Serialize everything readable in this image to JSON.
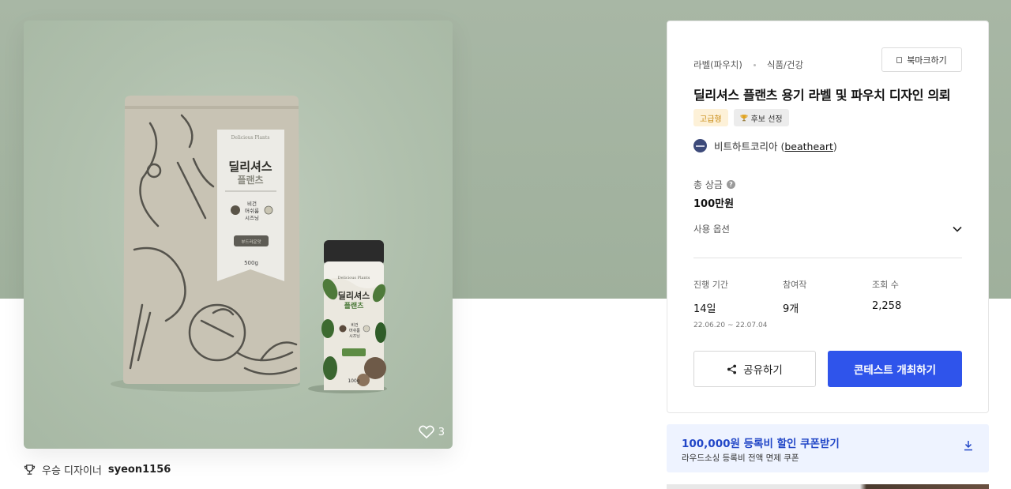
{
  "image": {
    "likes": "3",
    "bag": {
      "brand_script": "Delicious Plants",
      "name_line1": "딜리셔스",
      "name_line2": "플랜츠",
      "flavor_line1": "비건",
      "flavor_line2": "머쉬룸",
      "flavor_line3": "시즈닝",
      "tag": "부드러운맛",
      "weight": "500g"
    },
    "bottle": {
      "brand_script": "Delicious Plants",
      "name_line1": "딜리셔스",
      "name_line2": "플랜츠",
      "flavor_line1": "비건",
      "flavor_line2": "머쉬룸",
      "flavor_line3": "시즈닝",
      "weight": "100g"
    }
  },
  "winner": {
    "label": "우승 디자이너",
    "username": "syeon1156"
  },
  "panel": {
    "category": "라벨(파우치)",
    "subcategory": "식품/건강",
    "bookmark_label": "북마크하기",
    "title": "딜리셔스 플랜츠 용기 라벨 및 파우치 디자인 의뢰",
    "badge_premium": "고급형",
    "badge_candidate": "후보 선정",
    "host_name": "비트하트코리아",
    "host_handle": "beatheart",
    "prize_label": "총 상금",
    "prize_value": "100만원",
    "options_label": "사용 옵션",
    "stats": [
      {
        "label": "진행 기간",
        "value": "14일",
        "sub": "22.06.20 ~ 22.07.04"
      },
      {
        "label": "참여작",
        "value": "9개",
        "sub": ""
      },
      {
        "label": "조회 수",
        "value": "2,258",
        "sub": ""
      }
    ],
    "share_label": "공유하기",
    "contest_label": "콘테스트 개최하기"
  },
  "coupon": {
    "title": "100,000원 등록비 할인 쿠폰받기",
    "subtitle": "라우드소싱 등록비 전액 면제 쿠폰"
  },
  "colors": {
    "primary": "#2f54eb",
    "band": "#a2b39f",
    "premium_badge": "#c88a12"
  }
}
